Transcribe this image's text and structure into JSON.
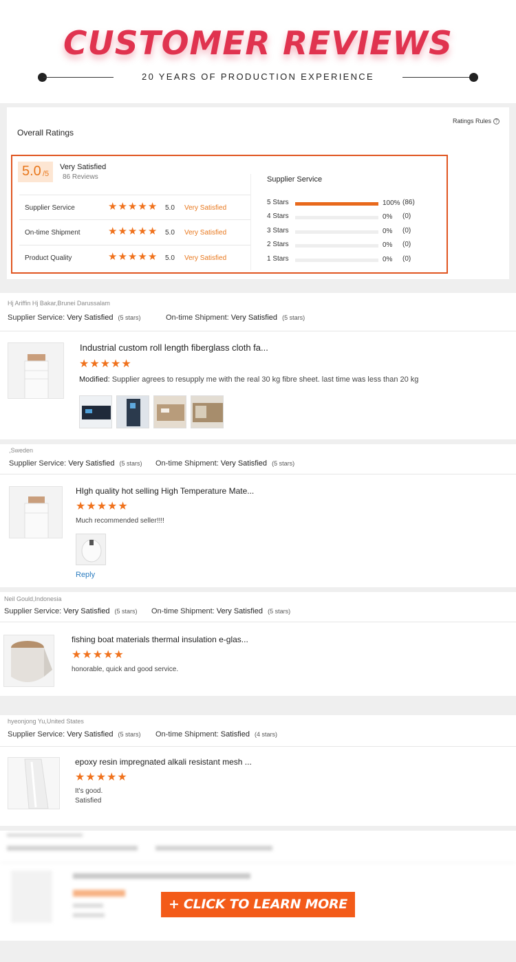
{
  "hero": {
    "title": "CUSTOMER REVIEWS",
    "subtitle": "20 YEARS OF PRODUCTION EXPERIENCE"
  },
  "overall": {
    "title": "Overall Ratings",
    "rules_label": "Ratings Rules",
    "score": "5.0",
    "score_max": "/5",
    "satisfaction": "Very Satisfied",
    "reviews_count": "86 Reviews",
    "categories": [
      {
        "name": "Supplier Service",
        "stars": 5,
        "score": "5.0",
        "label": "Very Satisfied"
      },
      {
        "name": "On-time Shipment",
        "stars": 5,
        "score": "5.0",
        "label": "Very Satisfied"
      },
      {
        "name": "Product Quality",
        "stars": 5,
        "score": "5.0",
        "label": "Very Satisfied"
      }
    ],
    "supplier_service_title": "Supplier Service",
    "distribution": [
      {
        "name": "5 Stars",
        "fraction": 1.0,
        "pct": "100%",
        "count": "(86)"
      },
      {
        "name": "4 Stars",
        "fraction": 0,
        "pct": "0%",
        "count": "(0)"
      },
      {
        "name": "3 Stars",
        "fraction": 0,
        "pct": "0%",
        "count": "(0)"
      },
      {
        "name": "2 Stars",
        "fraction": 0,
        "pct": "0%",
        "count": "(0)"
      },
      {
        "name": "1 Stars",
        "fraction": 0,
        "pct": "0%",
        "count": "(0)"
      }
    ]
  },
  "reviews": [
    {
      "author": "Hj Ariffin Hj Bakar,Brunei Darussalam",
      "supplier_label": "Supplier Service:",
      "supplier_value": "Very Satisfied",
      "supplier_stars": "(5 stars)",
      "shipment_label": "On-time Shipment:",
      "shipment_value": "Very Satisfied",
      "shipment_stars": "(5 stars)",
      "product": "Industrial custom roll length fiberglass cloth fa...",
      "stars": 5,
      "text_prefix": "Modified:",
      "text": " Supplier agrees to resupply me with the real 30 kg fibre sheet. last time was less than 20 kg",
      "photos": 4
    },
    {
      "author": ",Sweden",
      "supplier_label": "Supplier Service:",
      "supplier_value": "Very Satisfied",
      "supplier_stars": "(5 stars)",
      "shipment_label": "On-time Shipment:",
      "shipment_value": "Very Satisfied",
      "shipment_stars": "(5 stars)",
      "product": "HIgh quality hot selling High Temperature Mate...",
      "stars": 5,
      "text": "Much recommended seller!!!!",
      "reply": "Reply"
    },
    {
      "author": "Neil Gould,Indonesia",
      "supplier_label": "Supplier Service:",
      "supplier_value": "Very Satisfied",
      "supplier_stars": "(5 stars)",
      "shipment_label": "On-time Shipment:",
      "shipment_value": "Very Satisfied",
      "shipment_stars": "(5 stars)",
      "product": "fishing boat materials thermal insulation e-glas...",
      "stars": 5,
      "text": "honorable, quick and good service."
    },
    {
      "author": "hyeonjong Yu,United States",
      "supplier_label": "Supplier Service:",
      "supplier_value": "Very Satisfied",
      "supplier_stars": "(5 stars)",
      "shipment_label": "On-time Shipment:",
      "shipment_value": "Satisfied",
      "shipment_stars": "(4 stars)",
      "product": "epoxy resin impregnated alkali resistant mesh ...",
      "stars": 5,
      "text": "It's good.",
      "text2": "Satisfied"
    }
  ],
  "cta": {
    "label": "+ CLICK TO LEARN MORE"
  },
  "colors": {
    "accent": "#f35b19",
    "star": "#f0721d",
    "title": "#e0334f",
    "link": "#2a7bbf"
  }
}
